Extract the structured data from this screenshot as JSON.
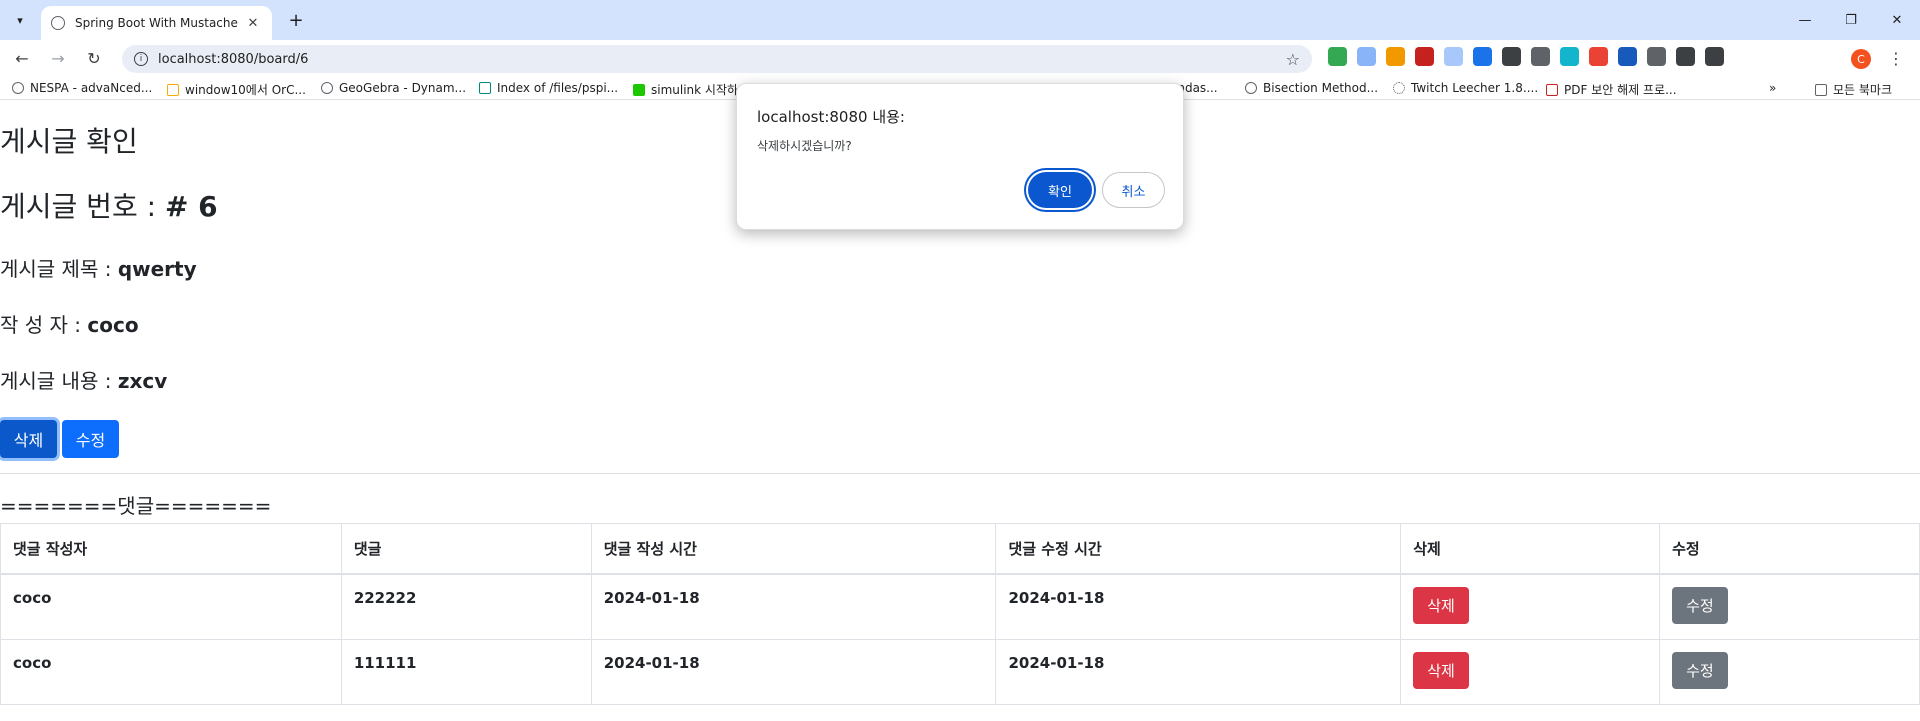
{
  "browser": {
    "tab_title": "Spring Boot With Mustache",
    "url": "localhost:8080/board/6",
    "profile_initial": "C",
    "bookmarks": [
      "NESPA - advaNced...",
      "window10에서 OrC...",
      "GeoGebra - Dynam...",
      "Index of /files/pspi...",
      "simulink 시작하",
      "andas...",
      "Bisection Method...",
      "Twitch Leecher 1.8....",
      "PDF 보안 해제 프로...",
      "모든 북마크"
    ]
  },
  "page": {
    "heading": "게시글 확인",
    "number_label": "게시글 번호 :",
    "number_value": "# 6",
    "title_label": "게시글 제목 :",
    "title_value": "qwerty",
    "author_label": "작 성 자 :",
    "author_value": "coco",
    "content_label": "게시글 내용 :",
    "content_value": "zxcv",
    "delete_label": "삭제",
    "edit_label": "수정",
    "comments_heading": "=======댓글======="
  },
  "comments": {
    "headers": [
      "댓글 작성자",
      "댓글",
      "댓글 작성 시간",
      "댓글 수정 시간",
      "삭제",
      "수정"
    ],
    "rows": [
      {
        "author": "coco",
        "text": "222222",
        "created": "2024-01-18",
        "updated": "2024-01-18",
        "delete": "삭제",
        "edit": "수정"
      },
      {
        "author": "coco",
        "text": "111111",
        "created": "2024-01-18",
        "updated": "2024-01-18",
        "delete": "삭제",
        "edit": "수정"
      }
    ]
  },
  "dialog": {
    "title": "localhost:8080 내용:",
    "message": "삭제하시겠습니까?",
    "ok_label": "확인",
    "cancel_label": "취소"
  },
  "colors": {
    "primary": "#0d6efd",
    "danger": "#dc3545",
    "secondary": "#6c757d",
    "chrome_tabbar": "#d3e3fd",
    "dialog_button": "#0b57d0"
  }
}
